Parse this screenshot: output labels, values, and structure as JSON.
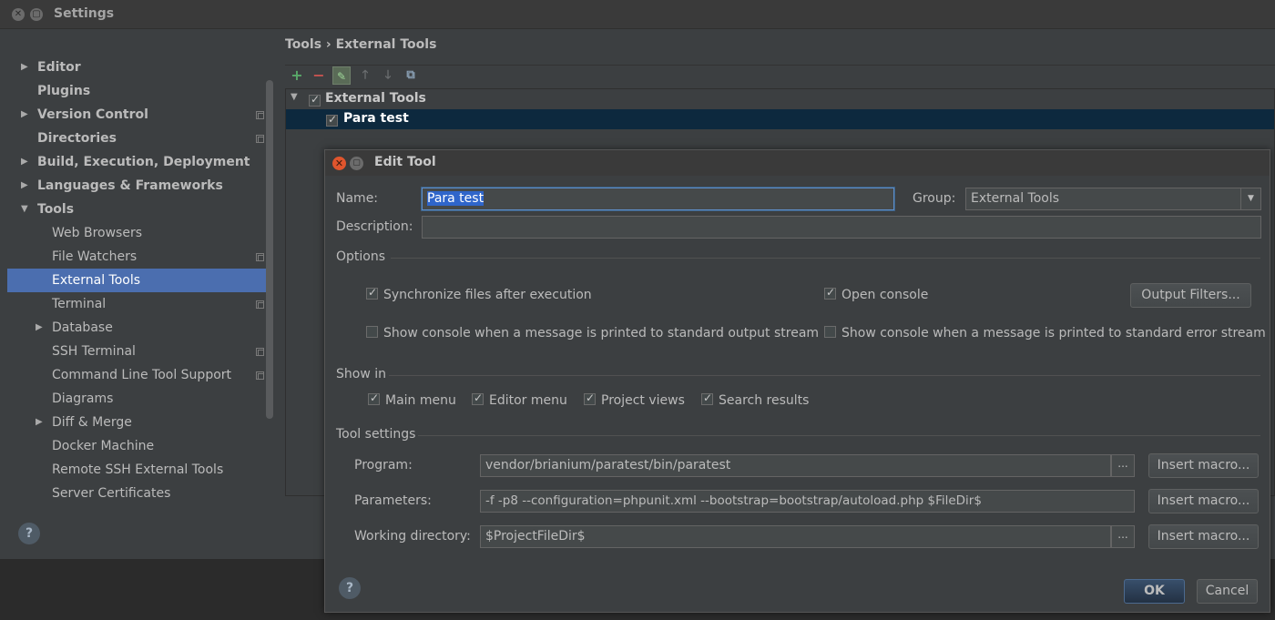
{
  "settings": {
    "title": "Settings",
    "breadcrumb": "Tools › External Tools",
    "sidebar": [
      {
        "label": "Editor",
        "bold": true,
        "arrow": "▶",
        "indent": 0,
        "copy": false
      },
      {
        "label": "Plugins",
        "bold": true,
        "arrow": "",
        "indent": 0,
        "copy": false
      },
      {
        "label": "Version Control",
        "bold": true,
        "arrow": "▶",
        "indent": 0,
        "copy": true
      },
      {
        "label": "Directories",
        "bold": true,
        "arrow": "",
        "indent": 0,
        "copy": true
      },
      {
        "label": "Build, Execution, Deployment",
        "bold": true,
        "arrow": "▶",
        "indent": 0,
        "copy": false
      },
      {
        "label": "Languages & Frameworks",
        "bold": true,
        "arrow": "▶",
        "indent": 0,
        "copy": false
      },
      {
        "label": "Tools",
        "bold": true,
        "arrow": "▼",
        "indent": 0,
        "copy": false
      },
      {
        "label": "Web Browsers",
        "bold": false,
        "arrow": "",
        "indent": 1,
        "copy": false
      },
      {
        "label": "File Watchers",
        "bold": false,
        "arrow": "",
        "indent": 1,
        "copy": true
      },
      {
        "label": "External Tools",
        "bold": false,
        "arrow": "",
        "indent": 1,
        "copy": false,
        "selected": true
      },
      {
        "label": "Terminal",
        "bold": false,
        "arrow": "",
        "indent": 1,
        "copy": true
      },
      {
        "label": "Database",
        "bold": false,
        "arrow": "▶",
        "indent": 1,
        "copy": false
      },
      {
        "label": "SSH Terminal",
        "bold": false,
        "arrow": "",
        "indent": 1,
        "copy": true
      },
      {
        "label": "Command Line Tool Support",
        "bold": false,
        "arrow": "",
        "indent": 1,
        "copy": true
      },
      {
        "label": "Diagrams",
        "bold": false,
        "arrow": "",
        "indent": 1,
        "copy": false
      },
      {
        "label": "Diff & Merge",
        "bold": false,
        "arrow": "▶",
        "indent": 1,
        "copy": false
      },
      {
        "label": "Docker Machine",
        "bold": false,
        "arrow": "",
        "indent": 1,
        "copy": false
      },
      {
        "label": "Remote SSH External Tools",
        "bold": false,
        "arrow": "",
        "indent": 1,
        "copy": false
      },
      {
        "label": "Server Certificates",
        "bold": false,
        "arrow": "",
        "indent": 1,
        "copy": false
      }
    ],
    "tools_tree": {
      "group_label": "External Tools",
      "item_label": "Para test"
    },
    "help_label": "?"
  },
  "dialog": {
    "title": "Edit Tool",
    "name_label": "Name:",
    "name_value": "Para test",
    "group_label": "Group:",
    "group_value": "External Tools",
    "description_label": "Description:",
    "description_value": "",
    "options_header": "Options",
    "sync_label": "Synchronize files after execution",
    "open_console_label": "Open console",
    "output_filters_label": "Output Filters...",
    "stdout_label": "Show console when a message is printed to standard output stream",
    "stderr_label": "Show console when a message is printed to standard error stream",
    "show_in_header": "Show in",
    "show_in": [
      {
        "label": "Main menu",
        "checked": true
      },
      {
        "label": "Editor menu",
        "checked": true
      },
      {
        "label": "Project views",
        "checked": true
      },
      {
        "label": "Search results",
        "checked": true
      }
    ],
    "tool_settings_header": "Tool settings",
    "program_label": "Program:",
    "program_value": "vendor/brianium/paratest/bin/paratest",
    "parameters_label": "Parameters:",
    "parameters_value": "-f -p8 --configuration=phpunit.xml --bootstrap=bootstrap/autoload.php $FileDir$",
    "working_dir_label": "Working directory:",
    "working_dir_value": "$ProjectFileDir$",
    "insert_macro_label": "Insert macro...",
    "dots_label": "...",
    "ok_label": "OK",
    "cancel_label": "Cancel",
    "help_label": "?"
  }
}
